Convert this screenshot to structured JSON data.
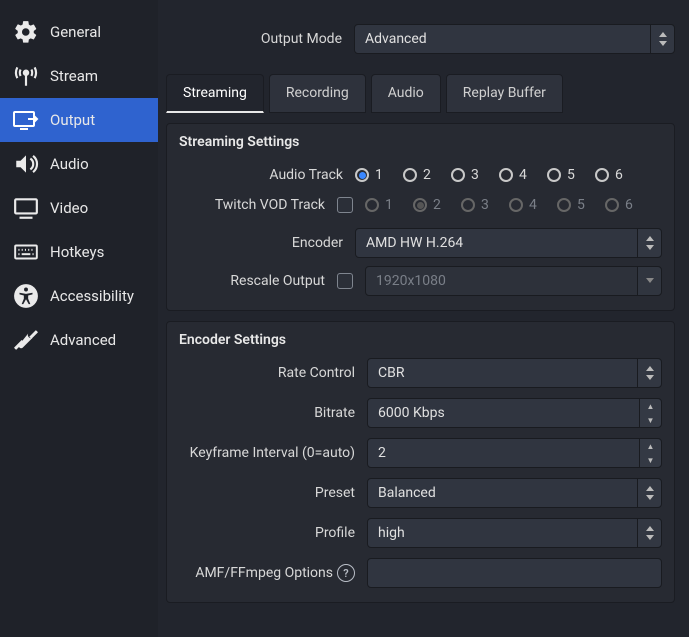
{
  "sidebar": {
    "items": [
      {
        "label": "General"
      },
      {
        "label": "Stream"
      },
      {
        "label": "Output"
      },
      {
        "label": "Audio"
      },
      {
        "label": "Video"
      },
      {
        "label": "Hotkeys"
      },
      {
        "label": "Accessibility"
      },
      {
        "label": "Advanced"
      }
    ]
  },
  "outputMode": {
    "label": "Output Mode",
    "value": "Advanced"
  },
  "tabs": [
    {
      "label": "Streaming"
    },
    {
      "label": "Recording"
    },
    {
      "label": "Audio"
    },
    {
      "label": "Replay Buffer"
    }
  ],
  "streaming": {
    "title": "Streaming Settings",
    "audioTrack": {
      "label": "Audio Track",
      "options": [
        "1",
        "2",
        "3",
        "4",
        "5",
        "6"
      ],
      "selected": "1"
    },
    "twitchVod": {
      "label": "Twitch VOD Track",
      "enabled": false,
      "options": [
        "1",
        "2",
        "3",
        "4",
        "5",
        "6"
      ],
      "selected": "2"
    },
    "encoder": {
      "label": "Encoder",
      "value": "AMD HW H.264"
    },
    "rescale": {
      "label": "Rescale Output",
      "enabled": false,
      "value": "1920x1080"
    }
  },
  "encoderSettings": {
    "title": "Encoder Settings",
    "rateControl": {
      "label": "Rate Control",
      "value": "CBR"
    },
    "bitrate": {
      "label": "Bitrate",
      "value": "6000 Kbps"
    },
    "keyframe": {
      "label": "Keyframe Interval (0=auto)",
      "value": "2"
    },
    "preset": {
      "label": "Preset",
      "value": "Balanced"
    },
    "profile": {
      "label": "Profile",
      "value": "high"
    },
    "amf": {
      "label": "AMF/FFmpeg Options",
      "value": ""
    }
  }
}
